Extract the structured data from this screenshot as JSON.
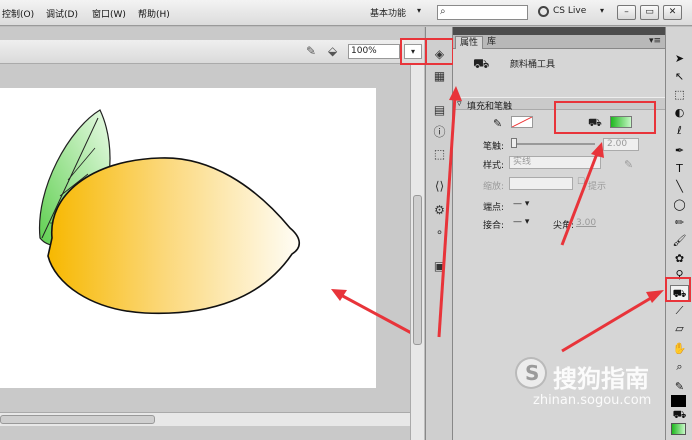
{
  "menu": {
    "items": [
      "控制(O)",
      "调试(D)",
      "窗口(W)",
      "帮助(H)"
    ]
  },
  "titlebar": {
    "workspace": "基本功能",
    "cslive": "CS Live"
  },
  "doc_toolbar": {
    "zoom": "100%"
  },
  "properties": {
    "tabs": [
      "属性",
      "库"
    ],
    "tool_name": "颜料桶工具",
    "section": "填充和笔触",
    "stroke_label": "笔触:",
    "stroke_value": "2.00",
    "style_label": "样式:",
    "style_value": "实线",
    "scale_label": "缩放:",
    "hint_label": "提示",
    "cap_label": "端点:",
    "join_label": "接合:",
    "miter_label": "尖角:",
    "miter_value": "3.00"
  },
  "watermark": {
    "brand": "搜狗指南",
    "url": "zhinan.sogou.com"
  },
  "colors": {
    "accent_red": "#e8343a",
    "fill_green": "#4cd964",
    "lemon": "#fbc02d"
  }
}
